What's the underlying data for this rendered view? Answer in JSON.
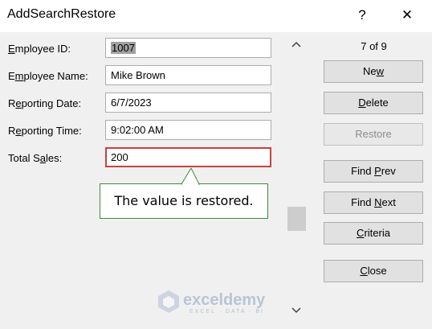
{
  "window": {
    "title": "AddSearchRestore",
    "help_label": "?",
    "close_label": "✕"
  },
  "fields": [
    {
      "label": "Employee ID:",
      "value": "1007"
    },
    {
      "label": "Employee Name:",
      "value": "Mike Brown"
    },
    {
      "label": "Reporting Date:",
      "value": "6/7/2023"
    },
    {
      "label": "Reporting Time:",
      "value": "9:02:00 AM"
    },
    {
      "label": "Total Sales:",
      "value": "200"
    }
  ],
  "callout": {
    "text": "The value is restored."
  },
  "record_counter": "7 of 9",
  "buttons": [
    {
      "label": "New",
      "disabled": false
    },
    {
      "label": "Delete",
      "disabled": false
    },
    {
      "label": "Restore",
      "disabled": true
    },
    {
      "label": "Find Prev",
      "disabled": false
    },
    {
      "label": "Find Next",
      "disabled": false
    },
    {
      "label": "Criteria",
      "disabled": false
    },
    {
      "label": "Close",
      "disabled": false
    }
  ],
  "scrollbar": {
    "up_icon": "chevron-up-icon",
    "down_icon": "chevron-down-icon"
  },
  "watermark": {
    "name": "exceldemy",
    "tagline": "EXCEL · DATA · BI"
  },
  "colors": {
    "highlight_border": "#c8423c",
    "callout_border": "#3d8a3d",
    "dialog_bg": "#f0f0f0"
  }
}
